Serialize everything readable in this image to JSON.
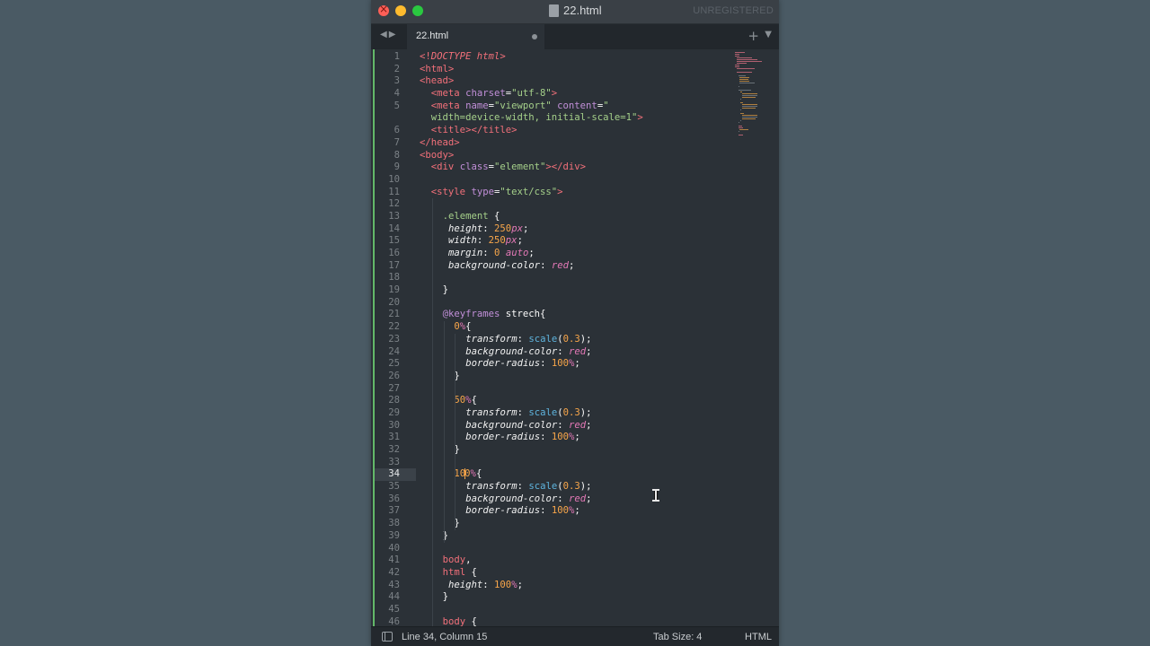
{
  "window": {
    "title": "22.html",
    "unregistered": "UNREGISTERED"
  },
  "tabs": [
    {
      "label": "22.html",
      "modified": true
    }
  ],
  "tabbar": {
    "back_icon": "triangle-left-icon",
    "forward_icon": "triangle-right-icon",
    "new_tab_icon": "plus-icon",
    "menu_icon": "triangle-down-icon"
  },
  "editor": {
    "active_line": 34,
    "lines": [
      {
        "n": 1,
        "indent": 0,
        "html": "<span class='t'>&lt;!</span><span class='dt'>DOCTYPE html</span><span class='t'>&gt;</span>"
      },
      {
        "n": 2,
        "indent": 0,
        "html": "<span class='t'>&lt;html&gt;</span>"
      },
      {
        "n": 3,
        "indent": 0,
        "html": "<span class='t'>&lt;head&gt;</span>"
      },
      {
        "n": 4,
        "indent": 2,
        "html": "<span class='t'>&lt;meta</span> <span class='a'>charset</span><span class='p'>=</span><span class='s'>\"utf-8\"</span><span class='t'>&gt;</span>"
      },
      {
        "n": 5,
        "indent": 2,
        "html": "<span class='t'>&lt;meta</span> <span class='a'>name</span><span class='p'>=</span><span class='s'>\"viewport\"</span> <span class='a'>content</span><span class='p'>=</span><span class='s'>\"</span>"
      },
      {
        "n": null,
        "indent": 2,
        "html": "<span class='s'>width=device-width, initial-scale=1\"</span><span class='t'>&gt;</span>"
      },
      {
        "n": 6,
        "indent": 2,
        "html": "<span class='t'>&lt;title&gt;&lt;/title&gt;</span>"
      },
      {
        "n": 7,
        "indent": 0,
        "html": "<span class='t'>&lt;/head&gt;</span>"
      },
      {
        "n": 8,
        "indent": 0,
        "html": "<span class='t'>&lt;body&gt;</span>"
      },
      {
        "n": 9,
        "indent": 2,
        "html": "<span class='t'>&lt;div</span> <span class='a'>class</span><span class='p'>=</span><span class='s'>\"element\"</span><span class='t'>&gt;&lt;/div&gt;</span>"
      },
      {
        "n": 10,
        "indent": 0,
        "html": ""
      },
      {
        "n": 11,
        "indent": 2,
        "html": "<span class='t'>&lt;style</span> <span class='a'>type</span><span class='p'>=</span><span class='s'>\"text/css\"</span><span class='t'>&gt;</span>"
      },
      {
        "n": 12,
        "indent": 0,
        "html": ""
      },
      {
        "n": 13,
        "indent": 4,
        "html": "<span class='s'>.element</span> <span class='p'>{</span>"
      },
      {
        "n": 14,
        "indent": 5,
        "html": "<span class='pr'>height</span><span class='p'>: </span><span class='n'>250</span><span class='v'>px</span><span class='p'>;</span>"
      },
      {
        "n": 15,
        "indent": 5,
        "html": "<span class='pr'>width</span><span class='p'>: </span><span class='n'>250</span><span class='v'>px</span><span class='p'>;</span>"
      },
      {
        "n": 16,
        "indent": 5,
        "html": "<span class='pr'>margin</span><span class='p'>: </span><span class='n'>0</span> <span class='v'>auto</span><span class='p'>;</span>"
      },
      {
        "n": 17,
        "indent": 5,
        "html": "<span class='pr'>background-color</span><span class='p'>: </span><span class='v'>red</span><span class='p'>;</span>"
      },
      {
        "n": 18,
        "indent": 0,
        "html": ""
      },
      {
        "n": 19,
        "indent": 4,
        "html": "<span class='p'>}</span>"
      },
      {
        "n": 20,
        "indent": 0,
        "html": ""
      },
      {
        "n": 21,
        "indent": 4,
        "html": "<span class='k'>@keyframes</span> <span class='p'>strech{</span>"
      },
      {
        "n": 22,
        "indent": 6,
        "html": "<span class='n'>0</span><span class='v'>%</span><span class='p'>{</span>"
      },
      {
        "n": 23,
        "indent": 8,
        "html": "<span class='pr'>transform</span><span class='p'>: </span><span class='f'>scale</span><span class='p'>(</span><span class='n'>0.3</span><span class='p'>);</span>"
      },
      {
        "n": 24,
        "indent": 8,
        "html": "<span class='pr'>background-color</span><span class='p'>: </span><span class='v'>red</span><span class='p'>;</span>"
      },
      {
        "n": 25,
        "indent": 8,
        "html": "<span class='pr'>border-radius</span><span class='p'>: </span><span class='n'>100</span><span class='v'>%</span><span class='p'>;</span>"
      },
      {
        "n": 26,
        "indent": 6,
        "html": "<span class='p'>}</span>"
      },
      {
        "n": 27,
        "indent": 0,
        "html": ""
      },
      {
        "n": 28,
        "indent": 6,
        "html": "<span class='n'>50</span><span class='v'>%</span><span class='p'>{</span>"
      },
      {
        "n": 29,
        "indent": 8,
        "html": "<span class='pr'>transform</span><span class='p'>: </span><span class='f'>scale</span><span class='p'>(</span><span class='n'>0.3</span><span class='p'>);</span>"
      },
      {
        "n": 30,
        "indent": 8,
        "html": "<span class='pr'>background-color</span><span class='p'>: </span><span class='v'>red</span><span class='p'>;</span>"
      },
      {
        "n": 31,
        "indent": 8,
        "html": "<span class='pr'>border-radius</span><span class='p'>: </span><span class='n'>100</span><span class='v'>%</span><span class='p'>;</span>"
      },
      {
        "n": 32,
        "indent": 6,
        "html": "<span class='p'>}</span>"
      },
      {
        "n": 33,
        "indent": 0,
        "html": ""
      },
      {
        "n": 34,
        "indent": 6,
        "html": "<span class='n'>10</span><span class='cursor'></span><span class='n'>0</span><span class='v'>%</span><span class='p'>{</span>"
      },
      {
        "n": 35,
        "indent": 8,
        "html": "<span class='pr'>transform</span><span class='p'>: </span><span class='f'>scale</span><span class='p'>(</span><span class='n'>0.3</span><span class='p'>);</span>"
      },
      {
        "n": 36,
        "indent": 8,
        "html": "<span class='pr'>background-color</span><span class='p'>: </span><span class='v'>red</span><span class='p'>;</span>"
      },
      {
        "n": 37,
        "indent": 8,
        "html": "<span class='pr'>border-radius</span><span class='p'>: </span><span class='n'>100</span><span class='v'>%</span><span class='p'>;</span>"
      },
      {
        "n": 38,
        "indent": 6,
        "html": "<span class='p'>}</span>"
      },
      {
        "n": 39,
        "indent": 4,
        "html": "<span class='p'>}</span>"
      },
      {
        "n": 40,
        "indent": 0,
        "html": ""
      },
      {
        "n": 41,
        "indent": 4,
        "html": "<span class='t'>body</span><span class='p'>,</span>"
      },
      {
        "n": 42,
        "indent": 4,
        "html": "<span class='t'>html</span> <span class='p'>{</span>"
      },
      {
        "n": 43,
        "indent": 5,
        "html": "<span class='pr'>height</span><span class='p'>: </span><span class='n'>100</span><span class='v'>%</span><span class='p'>;</span>"
      },
      {
        "n": 44,
        "indent": 4,
        "html": "<span class='p'>}</span>"
      },
      {
        "n": 45,
        "indent": 0,
        "html": ""
      },
      {
        "n": 46,
        "indent": 4,
        "html": "<span class='t'>body</span> <span class='p'>{</span>"
      }
    ]
  },
  "statusbar": {
    "position": "Line 34, Column 15",
    "tab_size": "Tab Size: 4",
    "syntax": "HTML"
  },
  "colors": {
    "tag": "#f2707a",
    "attribute": "#c18fd8",
    "string": "#a5d08a",
    "number": "#f8a64a",
    "function": "#5fb4de",
    "unit": "#e479b7",
    "gutter_modified": "#63b869"
  }
}
